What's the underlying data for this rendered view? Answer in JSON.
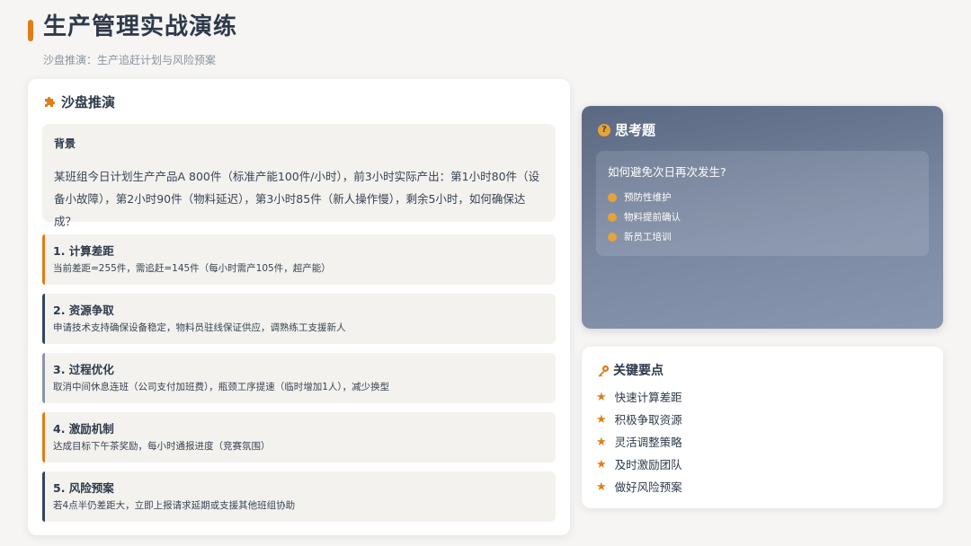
{
  "header": {
    "title": "生产管理实战演练",
    "subtitle": "沙盘推演：生产追赶计划与风险预案"
  },
  "sandbox": {
    "heading": "沙盘推演",
    "icon": "puzzle-icon",
    "background": {
      "title": "背景",
      "text": "某班组今日计划生产产品A 800件（标准产能100件/小时），前3小时实际产出：第1小时80件（设备小故障），第2小时90件（物料延迟），第3小时85件（新人操作慢），剩余5小时，如何确保达成？"
    },
    "steps": [
      {
        "title": "1. 计算差距",
        "desc": "当前差距=255件，需追赶=145件（每小时需产105件，超产能）",
        "accent": "#e07d16"
      },
      {
        "title": "2. 资源争取",
        "desc": "申请技术支持确保设备稳定，物料员驻线保证供应，调熟练工支援新人",
        "accent": "#34455a"
      },
      {
        "title": "3. 过程优化",
        "desc": "取消中间休息连班（公司支付加班费），瓶颈工序提速（临时增加1人），减少换型",
        "accent": "#8a96a8"
      },
      {
        "title": "4. 激励机制",
        "desc": "达成目标下午茶奖励，每小时通报进度（竞赛氛围）",
        "accent": "#e07d16"
      },
      {
        "title": "5. 风险预案",
        "desc": "若4点半仍差距大，立即上报请求延期或支援其他班组协助",
        "accent": "#34455a"
      }
    ]
  },
  "thinking": {
    "heading": "思考题",
    "icon": "question-circle-icon",
    "icon_glyph": "?",
    "question": "如何避免次日再次发生?",
    "items": [
      "预防性维护",
      "物料提前确认",
      "新员工培训"
    ]
  },
  "key_points": {
    "heading": "关键要点",
    "icon": "key-icon",
    "star_glyph": "★",
    "items": [
      "快速计算差距",
      "积极争取资源",
      "灵活调整策略",
      "及时激励团队",
      "做好风险预案"
    ]
  },
  "colors": {
    "accent": "#e07d16",
    "dark": "#34455a",
    "slate": "#8a96a8"
  }
}
